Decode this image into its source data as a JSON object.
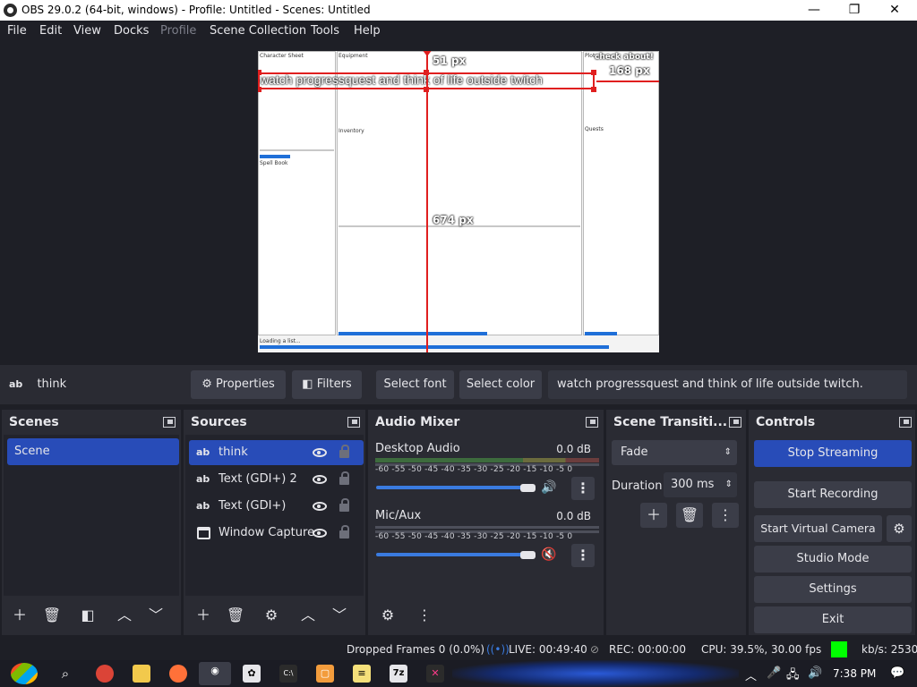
{
  "window": {
    "title": "OBS 29.0.2 (64-bit, windows) - Profile: Untitled - Scenes: Untitled",
    "min": "—",
    "max": "❐",
    "close": "✕"
  },
  "menu": [
    "File",
    "Edit",
    "View",
    "Docks",
    "Profile",
    "Scene Collection",
    "Tools",
    "Help"
  ],
  "preview": {
    "overlay_text": "watch progressquest and think of life outside twitch",
    "small_overlay": "check about!",
    "measure_top": "51 px",
    "measure_right": "168 px",
    "measure_bottom": "674 px",
    "pq_headers": [
      "Character Sheet",
      "Equipment",
      "Plot",
      "Spell Book",
      "Inventory",
      "Quests"
    ],
    "pq_status": "Loading a list..."
  },
  "context": {
    "source_icon": "ab",
    "source_name": "think",
    "properties": "Properties",
    "filters": "Filters",
    "select_font": "Select font",
    "select_color": "Select color",
    "text_value": "watch progressquest and think of life outside twitch."
  },
  "scenes": {
    "title": "Scenes",
    "items": [
      "Scene"
    ]
  },
  "sources": {
    "title": "Sources",
    "items": [
      {
        "icon": "ab",
        "name": "think"
      },
      {
        "icon": "ab",
        "name": "Text (GDI+) 2"
      },
      {
        "icon": "ab",
        "name": "Text (GDI+)"
      },
      {
        "icon": "window",
        "name": "Window Capture"
      }
    ]
  },
  "mixer": {
    "title": "Audio Mixer",
    "scale": "-60 -55 -50 -45 -40 -35 -30 -25 -20 -15 -10 -5 0",
    "channels": [
      {
        "name": "Desktop Audio",
        "db": "0.0 dB",
        "muted": false
      },
      {
        "name": "Mic/Aux",
        "db": "0.0 dB",
        "muted": true
      }
    ]
  },
  "transitions": {
    "title": "Scene Transiti...",
    "selected": "Fade",
    "duration_label": "Duration",
    "duration": "300 ms"
  },
  "controls": {
    "title": "Controls",
    "stop_streaming": "Stop Streaming",
    "start_recording": "Start Recording",
    "start_virtual_camera": "Start Virtual Camera",
    "studio_mode": "Studio Mode",
    "settings": "Settings",
    "exit": "Exit"
  },
  "status": {
    "dropped": "Dropped Frames 0 (0.0%)",
    "live": "LIVE: 00:49:40",
    "rec": "REC: 00:00:00",
    "cpu": "CPU: 39.5%, 30.00 fps",
    "kbs": "kb/s: 2530"
  },
  "taskbar": {
    "time": "7:38 PM"
  },
  "colors": {
    "accent": "#284cb8",
    "live_ok": "#00ff00",
    "guide": "#e01f1f"
  }
}
